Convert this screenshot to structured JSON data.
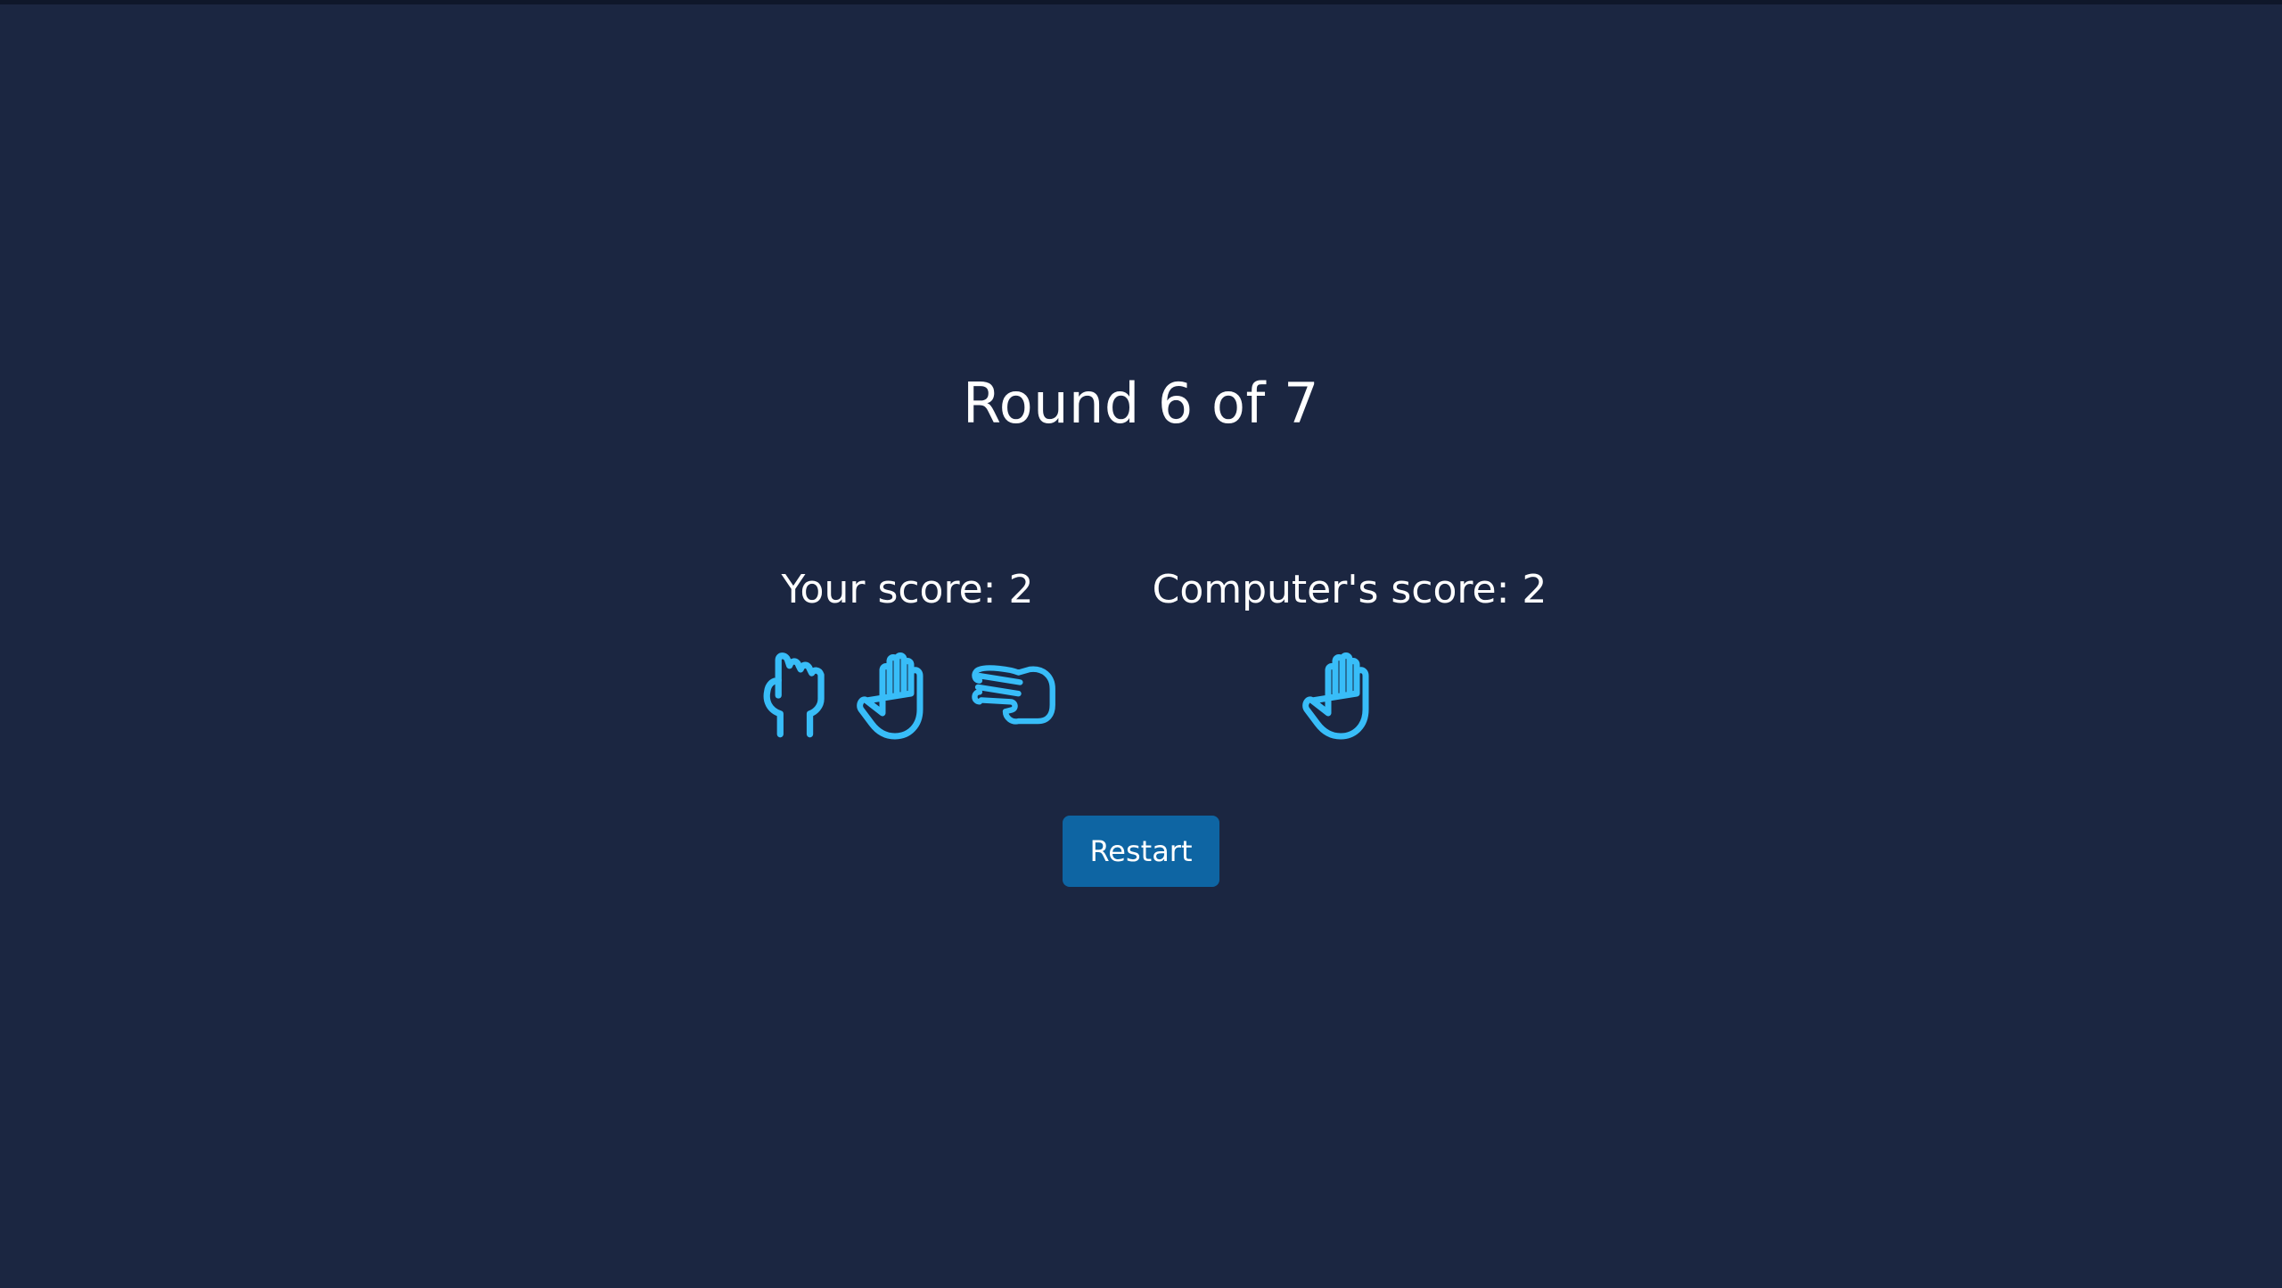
{
  "game": {
    "round_label": "Round 6 of 7"
  },
  "scores": {
    "player_label": "Your score: 2",
    "computer_label": "Computer's score: 2"
  },
  "player_moves": [
    {
      "icon": "rock-icon"
    },
    {
      "icon": "paper-icon"
    },
    {
      "icon": "scissors-icon"
    }
  ],
  "computer_moves": [
    {
      "icon": "paper-icon"
    }
  ],
  "controls": {
    "restart_label": "Restart"
  },
  "colors": {
    "background": "#1b2641",
    "icon": "#38bdf8",
    "button": "#0e65a3",
    "text": "#ffffff"
  }
}
